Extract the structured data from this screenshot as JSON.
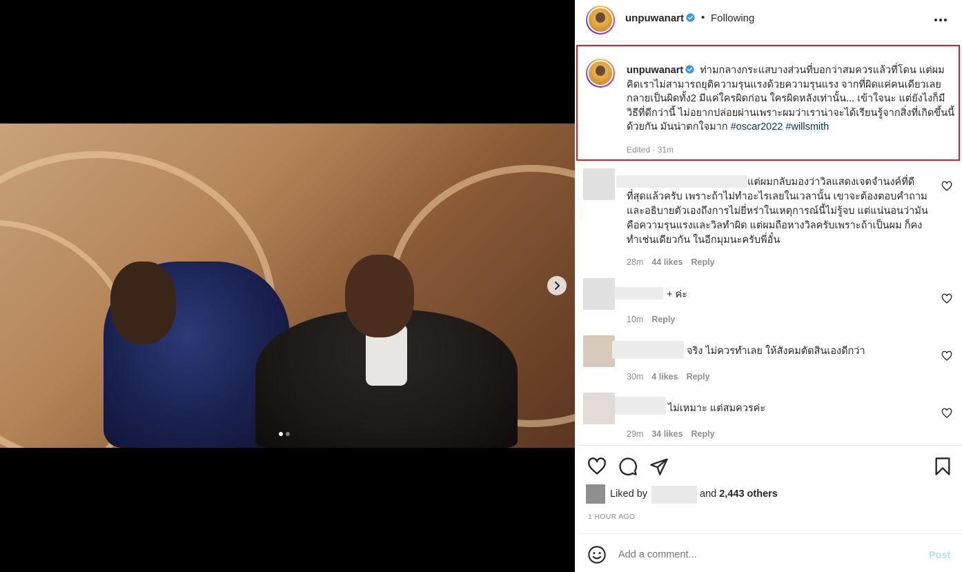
{
  "post": {
    "username": "unpuwanart",
    "follow_separator": "•",
    "follow_state": "Following",
    "caption": {
      "username": "unpuwanart",
      "text": "ท่ามกลางกระแสบางส่วนที่บอกว่าสมควรแล้วที่โดน แต่ผมคิดเราไม่สามารถยุติความรุนแรงด้วยความรุนแรง จากที่ผิดแค่คนเดียวเลยกลายเป็นผิดทั้ง2 มีแค่ใครผิดก่อน ใครผิดหลังเท่านั้น... เข้าใจนะ แต่ยังไงก็มีวิธีที่ดีกว่านี้ ไม่อยากปล่อยผ่านเพราะผมว่าเราน่าจะได้เรียนรู้จากสิ่งที่เกิดขึ้นนี้ด้วยกัน มันน่าตกใจมาก",
      "hashtags": [
        "#oscar2022",
        "#willsmith"
      ],
      "meta": "Edited · 31m"
    }
  },
  "comments": [
    {
      "text": "แต่ผมกลับมองว่าวิลแสดงเจตจำนงค์ที่ดีที่สุดแล้วครับ เพราะถ้าไม่ทำอะไรเลยในเวลานั้น เขาจะต้องตอบคำถามและอธิบายตัวเองถึงการไม่ยี่หร่าในเหตุการณ์นี้ไม่รู้จบ แต่แน่นอนว่ามันคือความรุนแรงและวิลทำผิด แต่ผมถือหางวิลครับเพราะถ้าเป็นผม ก็คงทำเช่นเดียวกัน ในอีกมุมนะครับพี่อั๋น",
      "time": "28m",
      "likes": "44 likes",
      "reply": "Reply"
    },
    {
      "text": "+ ค่ะ",
      "time": "10m",
      "likes": "",
      "reply": "Reply"
    },
    {
      "text": "จริง ไม่ควรทำเลย ให้สังคมตัดสินเองดีกว่า",
      "time": "30m",
      "likes": "4 likes",
      "reply": "Reply"
    },
    {
      "text": "ไม่เหมาะ แต่สมควรค่ะ",
      "time": "29m",
      "likes": "34 likes",
      "reply": "Reply"
    }
  ],
  "likes": {
    "prefix": "Liked by",
    "and_text": "and",
    "others": "2,443 others"
  },
  "time_ago": "1 HOUR AGO",
  "add_comment": {
    "placeholder": "Add a comment...",
    "post_label": "Post"
  },
  "icons": {
    "verified": "verified-badge-icon",
    "more": "more-options-icon",
    "next": "chevron-right-icon",
    "like": "heart-icon",
    "comment": "comment-bubble-icon",
    "share": "paper-plane-icon",
    "save": "bookmark-icon",
    "emoji": "emoji-smile-icon"
  },
  "colors": {
    "highlight_border": "#d4202a",
    "verified_blue": "#3897f0",
    "hashtag": "#00376b",
    "post_button_disabled": "#b2dffc"
  }
}
